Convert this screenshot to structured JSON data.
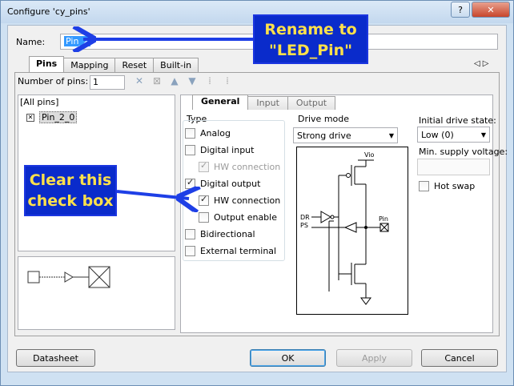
{
  "window": {
    "title": "Configure 'cy_pins'",
    "help_label": "?",
    "close_label": "✕"
  },
  "name_field": {
    "label": "Name:",
    "value": "Pin_2"
  },
  "tabs": [
    {
      "label": "Pins",
      "active": true
    },
    {
      "label": "Mapping"
    },
    {
      "label": "Reset"
    },
    {
      "label": "Built-in"
    }
  ],
  "tab_scroll": {
    "left": "◁",
    "right": "▷"
  },
  "pins": {
    "count_label": "Number of pins:",
    "count_value": "1"
  },
  "tree": {
    "root": "[All pins]",
    "item": "Pin_2_0"
  },
  "subtabs": [
    {
      "label": "General",
      "active": true
    },
    {
      "label": "Input"
    },
    {
      "label": "Output"
    }
  ],
  "type": {
    "label": "Type",
    "options": [
      {
        "label": "Analog",
        "checked": false
      },
      {
        "label": "Digital input",
        "checked": false
      },
      {
        "label": "HW connection",
        "checked": true,
        "disabled": true
      },
      {
        "label": "Digital output",
        "checked": true
      },
      {
        "label": "HW connection",
        "checked": true
      },
      {
        "label": "Output enable",
        "checked": false
      },
      {
        "label": "Bidirectional",
        "checked": false
      },
      {
        "label": "External terminal",
        "checked": false
      }
    ]
  },
  "drive_mode": {
    "label": "Drive mode",
    "value": "Strong drive",
    "circuit_labels": {
      "vio": "Vio",
      "dr": "DR",
      "ps": "PS",
      "pin": "Pin"
    }
  },
  "initial_drive": {
    "label": "Initial drive state:",
    "value": "Low (0)"
  },
  "min_supply": {
    "label": "Min. supply voltage:",
    "value": ""
  },
  "hot_swap": {
    "label": "Hot swap",
    "checked": false
  },
  "buttons": {
    "datasheet": "Datasheet",
    "ok": "OK",
    "apply": "Apply",
    "cancel": "Cancel"
  },
  "annotations": {
    "rename_line1": "Rename to",
    "rename_line2": "\"LED_Pin\"",
    "clear_line1": "Clear this",
    "clear_line2": "check box"
  },
  "colors": {
    "annotation_bg": "#0a2bcb",
    "annotation_text": "#ffe14a",
    "arrow": "#1e3fe6"
  }
}
